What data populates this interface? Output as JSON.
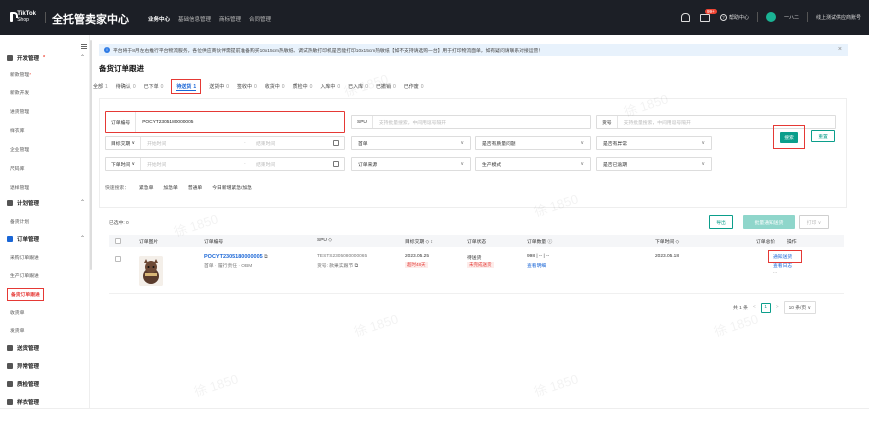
{
  "topbar": {
    "logo_line1": "TikTok",
    "logo_line2": "Shop",
    "product_name": "全托管卖家中心",
    "nav": [
      "业务中心",
      "基础信息管理",
      "商标管理",
      "合同管理"
    ],
    "badge": "99+",
    "help": "帮助中心",
    "user": "一ハ二",
    "shop": "线上测试供应商账号"
  },
  "sidebar": {
    "groups": [
      {
        "label": "开发管理",
        "items": [
          "新款管理",
          "新款开发",
          "进货管理",
          "样衣库",
          "企业管理",
          "尺码库",
          "退样管理"
        ]
      },
      {
        "label": "计划管理",
        "items": [
          "备货计划"
        ]
      },
      {
        "label": "订单管理",
        "items": [
          "采购订单跟进",
          "生产订单跟进",
          "备货订单跟进",
          "收货单",
          "发货单"
        ]
      },
      {
        "label": "送货管理",
        "items": []
      },
      {
        "label": "异常管理",
        "items": []
      },
      {
        "label": "质检管理",
        "items": []
      },
      {
        "label": "样衣管理",
        "items": []
      }
    ],
    "star": "*"
  },
  "notice": {
    "text": "平台将于8月左右推行平台物流服务，各位供应商伙伴需提前准备购买10x15cm热敏纸、调试热敏打印机是否能打印10x15cm热敏纸【如不支持请选购一台】用于打印物流面单，如有疑问请联系对接运营！",
    "close": "×",
    "info": "i"
  },
  "page_title": "备货订单跟进",
  "tabs": [
    {
      "label": "全部",
      "count": "1"
    },
    {
      "label": "待确认",
      "count": "0"
    },
    {
      "label": "已下单",
      "count": "0"
    },
    {
      "label": "待送货",
      "count": "1"
    },
    {
      "label": "送货中",
      "count": "0"
    },
    {
      "label": "签收中",
      "count": "0"
    },
    {
      "label": "收货中",
      "count": "0"
    },
    {
      "label": "质检中",
      "count": "0"
    },
    {
      "label": "入库中",
      "count": "0"
    },
    {
      "label": "已入库",
      "count": "0"
    },
    {
      "label": "已撤销",
      "count": "0"
    },
    {
      "label": "已作废",
      "count": "0"
    }
  ],
  "filters": {
    "order_no_label": "订单编号",
    "order_no_value": "POCYT2305180000005",
    "spu_label": "SPU",
    "spu_placeholder": "支持批量搜索，中间用逗号隔开",
    "goods_no_label": "货号",
    "goods_no_placeholder": "支持批量搜索，中间用逗号隔开",
    "target_date_label": "目标交期",
    "order_date_label": "下单时间",
    "start_placeholder": "开始时间",
    "end_placeholder": "结束时间",
    "source_label": "订单来源",
    "first_order": "首单",
    "produce_mode": "生产模式",
    "quality_issue": "是否有质量问题",
    "has_exception": "是否有异常",
    "is_overdue": "是否已逾期",
    "dropdown_caret": "∨",
    "range_dash": "-",
    "search_button": "搜索",
    "reset_button": "重置"
  },
  "quick_search": {
    "label": "快速搜索：",
    "options": [
      "紧急单",
      "加急单",
      "普通单",
      "今日新增紧急/加急"
    ]
  },
  "actions": {
    "selected": "已选中: 0",
    "export": "导出",
    "batch_delivery": "批量通知送货",
    "print": "打印 ∨"
  },
  "table": {
    "headers": [
      "订单图片",
      "订单编号",
      "SPU ◇",
      "目标交期 ◇ ↕",
      "订单状态",
      "订单数量 ⓘ",
      "下单时间 ◇",
      "订单总价",
      "操作"
    ],
    "rows": [
      {
        "order_no": "POCYT2305180000005",
        "copy_icon": "⧉",
        "tags": "首单  · 履行责任 · OBM",
        "spu": "TESTS2305080000065",
        "goods_no": "货号: 款果实跟节 ⧉",
        "target_date": "2023.05.25",
        "urgent_tag": "超时48天",
        "status": "待送货",
        "status_tag": "未完成送货",
        "quantity": "998 | -- | --",
        "quantity_link": "查看明细",
        "order_time": "2023.05.18",
        "total": "",
        "op_notify": "通知送货",
        "op_log": "查看日志",
        "op_more": "..."
      }
    ]
  },
  "pager": {
    "total": "共 1 条",
    "prev": "<",
    "page": "1",
    "next": ">",
    "size": "10 条/页 ∨"
  },
  "watermark": "徐 1850"
}
